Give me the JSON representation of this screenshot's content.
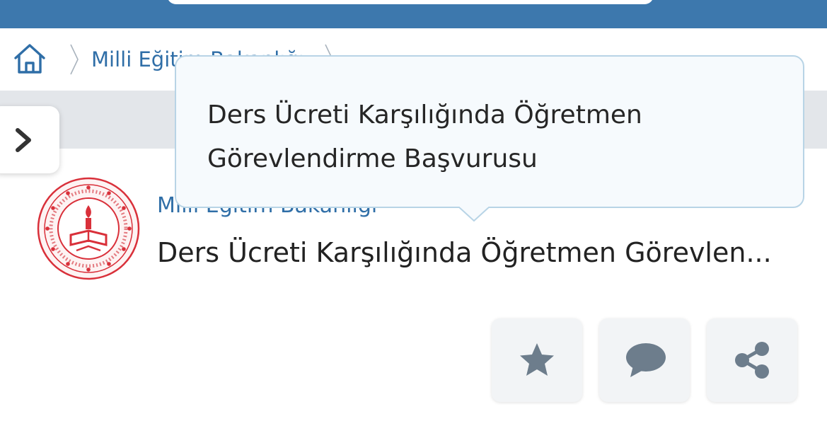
{
  "header": {
    "search_placeholder": ""
  },
  "breadcrumb": {
    "home_icon": "home-icon",
    "items": [
      "Milli Eğitim Bakanlığı"
    ]
  },
  "sidebar_toggle": {
    "icon": "chevron-right-icon"
  },
  "service": {
    "institution": "Milli Eğitim Bakanlığı",
    "title": "Ders Ücreti Karşılığında Öğretmen Görevlen..."
  },
  "tooltip": {
    "line1": "Ders Ücreti Karşılığında Öğretmen",
    "line2": "Görevlendirme Başvurusu"
  },
  "actions": [
    {
      "icon": "star-icon"
    },
    {
      "icon": "comment-icon"
    },
    {
      "icon": "share-icon"
    }
  ],
  "colors": {
    "header_blue": "#3d78ad",
    "link_blue": "#2f6ea7",
    "logo_red": "#d9303a",
    "icon_gray": "#6d7d8c"
  }
}
